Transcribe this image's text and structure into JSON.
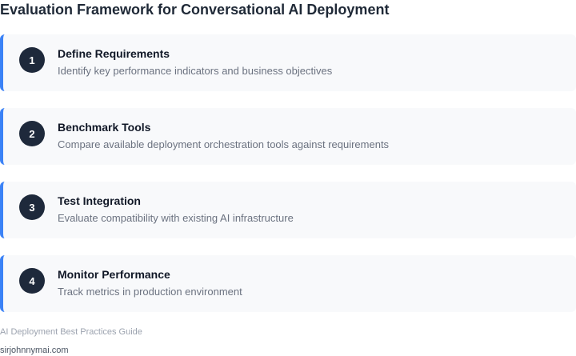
{
  "page": {
    "title": "Evaluation Framework for Conversational AI Deployment"
  },
  "colors": {
    "accent": "#3b82f6",
    "badge": "#1e293b",
    "card_background": "#f8f9fb"
  },
  "steps": [
    {
      "number": "1",
      "title": "Define Requirements",
      "description": "Identify key performance indicators and business objectives"
    },
    {
      "number": "2",
      "title": "Benchmark Tools",
      "description": "Compare available deployment orchestration tools against requirements"
    },
    {
      "number": "3",
      "title": "Test Integration",
      "description": "Evaluate compatibility with existing AI infrastructure"
    },
    {
      "number": "4",
      "title": "Monitor Performance",
      "description": "Track metrics in production environment"
    }
  ],
  "footer": {
    "guide": "AI Deployment Best Practices Guide",
    "site": "sirjohnnymai.com"
  }
}
